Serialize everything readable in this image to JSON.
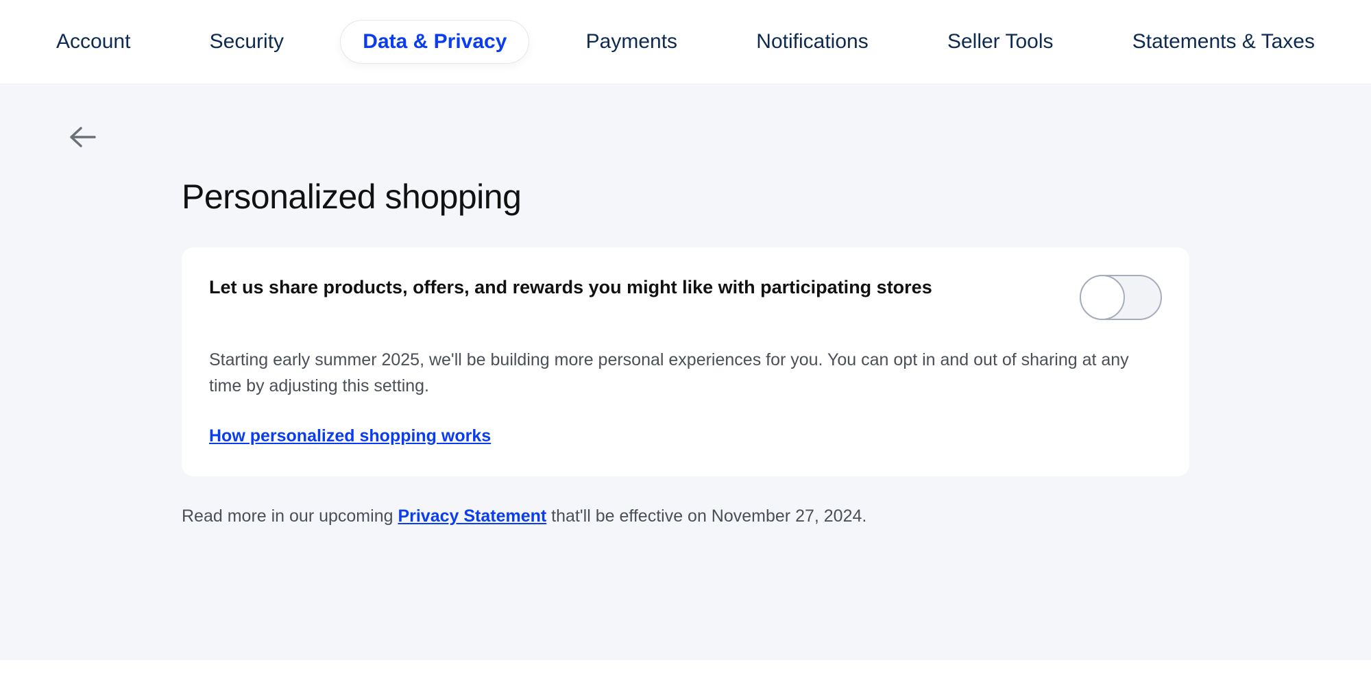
{
  "tabs": [
    {
      "label": "Account",
      "active": false
    },
    {
      "label": "Security",
      "active": false
    },
    {
      "label": "Data & Privacy",
      "active": true
    },
    {
      "label": "Payments",
      "active": false
    },
    {
      "label": "Notifications",
      "active": false
    },
    {
      "label": "Seller Tools",
      "active": false
    },
    {
      "label": "Statements & Taxes",
      "active": false
    }
  ],
  "page": {
    "title": "Personalized shopping"
  },
  "card": {
    "title": "Let us share products, offers, and rewards you might like with participating stores",
    "body": "Starting early summer 2025, we'll be building more personal experiences for you. You can opt in and out of sharing at any time by adjusting this setting.",
    "link": "How personalized shopping works",
    "toggle_state": "off"
  },
  "footer": {
    "prefix": "Read more in our upcoming ",
    "link": "Privacy Statement",
    "suffix": " that'll be effective on November 27, 2024."
  }
}
